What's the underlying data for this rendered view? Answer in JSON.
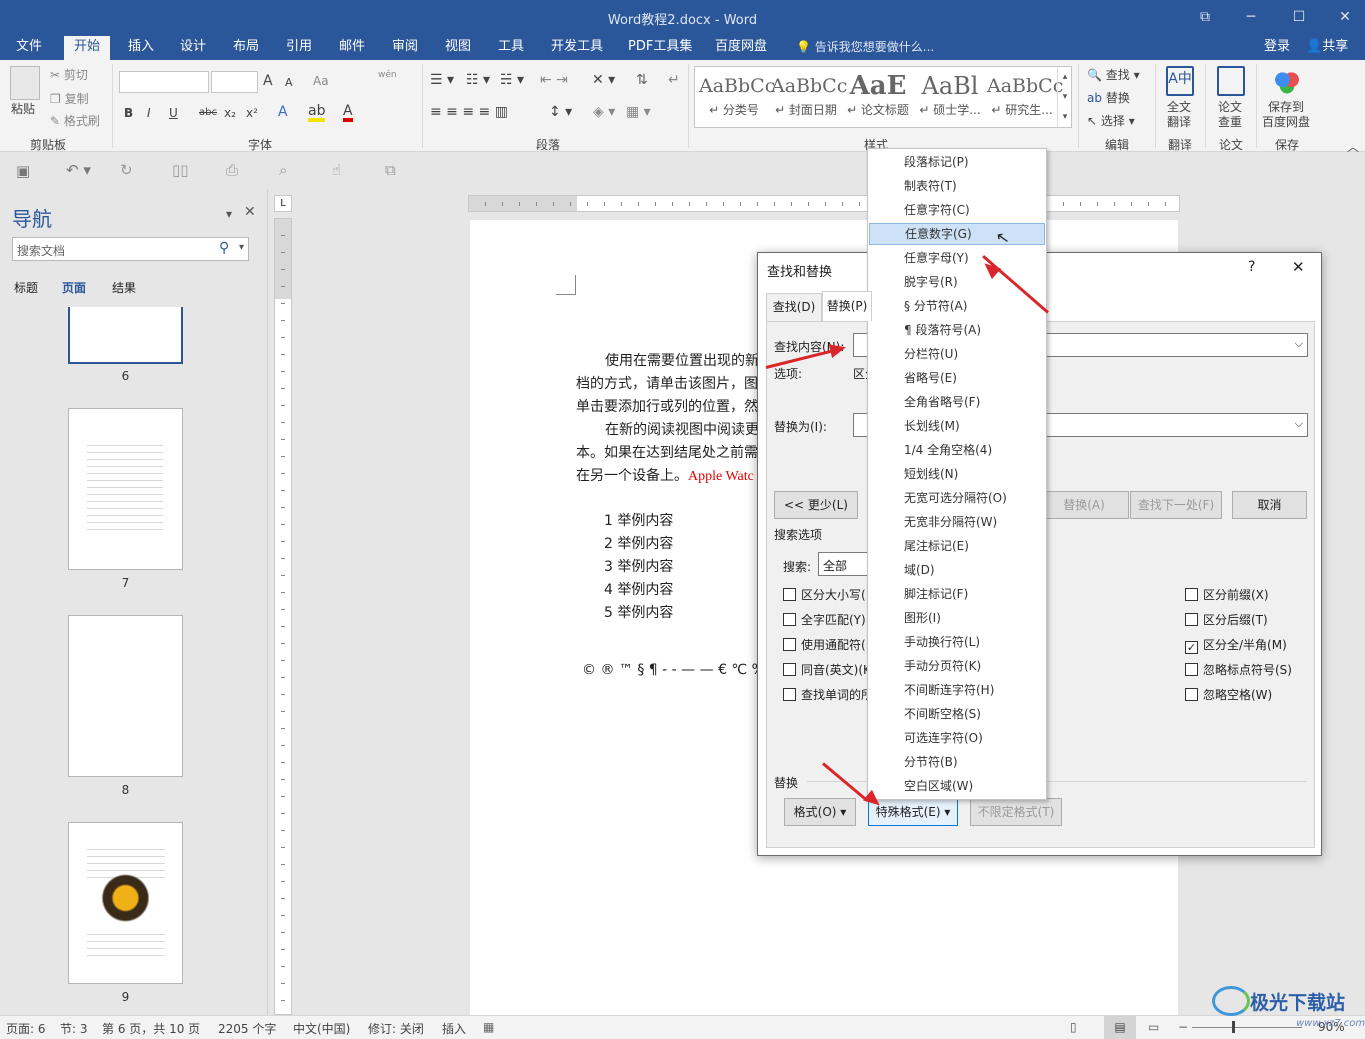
{
  "window": {
    "title": "Word教程2.docx - Word",
    "restore_icon": "⧉",
    "minimize": "─",
    "maximize": "☐",
    "close": "✕"
  },
  "menubar": {
    "tabs": [
      "文件",
      "开始",
      "插入",
      "设计",
      "布局",
      "引用",
      "邮件",
      "审阅",
      "视图",
      "工具",
      "开发工具",
      "PDF工具集",
      "百度网盘"
    ],
    "active": "开始",
    "tellme": "告诉我您想要做什么...",
    "login": "登录",
    "share": "共享"
  },
  "ribbon": {
    "clipboard": {
      "paste": "粘贴",
      "cut": "剪切",
      "copy": "复制",
      "format_painter": "格式刷",
      "label": "剪贴板"
    },
    "font": {
      "label": "字体",
      "bold": "B",
      "italic": "I",
      "underline": "U",
      "strike": "abc",
      "sub": "x₂",
      "sup": "x²",
      "grow": "A",
      "shrink": "A",
      "aa": "Aa",
      "pinyin": "wén"
    },
    "paragraph": {
      "label": "段落"
    },
    "styles": {
      "label": "样式",
      "items": [
        {
          "sample": "AaBbCc",
          "name": "↵ 分类号"
        },
        {
          "sample": "AaBbCc",
          "name": "↵ 封面日期"
        },
        {
          "sample": "AaE",
          "name": "↵ 论文标题"
        },
        {
          "sample": "AaBl",
          "name": "↵ 硕士学..."
        },
        {
          "sample": "AaBbCc",
          "name": "↵ 研究生..."
        }
      ]
    },
    "editing": {
      "label": "编辑",
      "find": "查找",
      "replace": "替换",
      "select": "选择"
    },
    "translate": {
      "label": "翻译",
      "btn": "全文\n翻译"
    },
    "paper": {
      "label": "论文",
      "btn": "论文\n查重"
    },
    "save": {
      "label": "保存",
      "btn": "保存到\n百度网盘"
    }
  },
  "nav": {
    "title": "导航",
    "search_placeholder": "搜索文档",
    "tabs": [
      "标题",
      "页面",
      "结果"
    ],
    "active_tab": "页面",
    "pages": [
      "6",
      "7",
      "8",
      "9"
    ]
  },
  "document": {
    "paragraphs": [
      "使用在需要位置出现的新",
      "档的方式，请单击该图片，图",
      "单击要添加行或列的位置，然",
      "在新的阅读视图中阅读更",
      "本。如果在达到结尾处之前需",
      "在另一个设备上。"
    ],
    "red_text": "Apple Watc",
    "list": [
      "1 举例内容",
      "2 举例内容",
      "3 举例内容",
      "4 举例内容",
      "5 举例内容"
    ],
    "symbols": "© ® ™ § ¶ - - — — € ℃ % ‰"
  },
  "dialog": {
    "title": "查找和替换",
    "help": "?",
    "close": "✕",
    "tabs": [
      "查找(D)",
      "替换(P)"
    ],
    "find_label": "查找内容(N):",
    "options_label": "选项:",
    "options_value": "区分",
    "replace_label": "替换为(I):",
    "less_btn": "<< 更少(L)",
    "replace_btn": "替换(A)",
    "find_next_btn": "查找下一处(F)",
    "cancel_btn": "取消",
    "search_options": "搜索选项",
    "search_label": "搜索:",
    "search_value": "全部",
    "left_checks": [
      "区分大小写(",
      "全字匹配(Y)",
      "使用通配符(",
      "同音(英文)(K",
      "查找单词的所"
    ],
    "right_checks": [
      {
        "label": "区分前缀(X)",
        "checked": false
      },
      {
        "label": "区分后缀(T)",
        "checked": false
      },
      {
        "label": "区分全/半角(M)",
        "checked": true
      },
      {
        "label": "忽略标点符号(S)",
        "checked": false
      },
      {
        "label": "忽略空格(W)",
        "checked": false
      }
    ],
    "replace_section": "替换",
    "format_btn": "格式(O) ▾",
    "special_btn": "特殊格式(E) ▾",
    "noformat_btn": "不限定格式(T)"
  },
  "special_menu": {
    "items": [
      "段落标记(P)",
      "制表符(T)",
      "任意字符(C)",
      "任意数字(G)",
      "任意字母(Y)",
      "脱字号(R)",
      "§ 分节符(A)",
      "¶ 段落符号(A)",
      "分栏符(U)",
      "省略号(E)",
      "全角省略号(F)",
      "长划线(M)",
      "1/4 全角空格(4)",
      "短划线(N)",
      "无宽可选分隔符(O)",
      "无宽非分隔符(W)",
      "尾注标记(E)",
      "域(D)",
      "脚注标记(F)",
      "图形(I)",
      "手动换行符(L)",
      "手动分页符(K)",
      "不间断连字符(H)",
      "不间断空格(S)",
      "可选连字符(O)",
      "分节符(B)",
      "空白区域(W)"
    ],
    "highlighted": "任意数字(G)"
  },
  "statusbar": {
    "page": "页面: 6",
    "section": "节: 3",
    "pages": "第 6 页，共 10 页",
    "words": "2205 个字",
    "lang": "中文(中国)",
    "track": "修订: 关闭",
    "insert": "插入",
    "zoom": "90%"
  },
  "watermark": {
    "text": "极光下载站",
    "url": "www.xz7.com"
  },
  "colors": {
    "brand": "#2b579a",
    "arrow": "#d9262b",
    "highlight": "#cde2f7"
  }
}
